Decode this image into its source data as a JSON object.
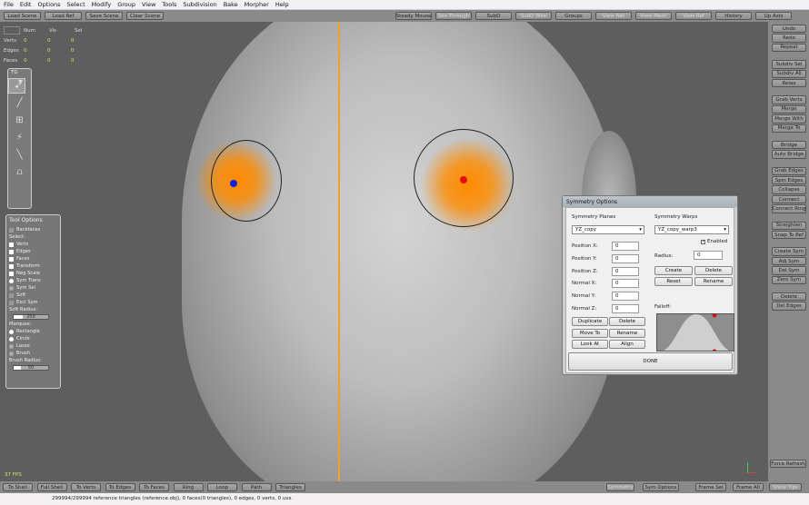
{
  "menu": [
    "File",
    "Edit",
    "Options",
    "Select",
    "Modify",
    "Group",
    "View",
    "Tools",
    "Subdivision",
    "Bake",
    "Morpher",
    "Help"
  ],
  "toolbar_left": [
    "Load Scene",
    "Load Ref",
    "Save Scene",
    "Clear Scene"
  ],
  "toolbar_right": [
    "Steady Mouse",
    "See Through",
    "SubD",
    "SubD Wire",
    "Groups",
    "View Net",
    "View Mesh",
    "View Ref",
    "History",
    "Up Axis"
  ],
  "stats": {
    "headers": [
      "Num",
      "Vis",
      "Sel"
    ],
    "rows": [
      {
        "label": "Verts",
        "values": [
          "0",
          "0",
          "0"
        ]
      },
      {
        "label": "Edges",
        "values": [
          "0",
          "0",
          "0"
        ]
      },
      {
        "label": "Faces",
        "values": [
          "0",
          "0",
          "0"
        ]
      }
    ]
  },
  "toolbox": {
    "title": "TG",
    "icons": [
      "select-arrow-icon",
      "cut-icon",
      "knife-icon",
      "extrude-icon",
      "brush-icon",
      "paint-icon",
      "stamp-icon"
    ]
  },
  "tool_options": {
    "title": "Tool Options",
    "backfaces": "Backfaces",
    "select_label": "Select:",
    "select_items": [
      "Verts",
      "Edges",
      "Faces"
    ],
    "transform_items": [
      "Transform",
      "Neg Scale",
      "Sym Trans",
      "Sym Sel",
      "Soft",
      "Excl Sym"
    ],
    "soft_radius_label": "Soft Radius:",
    "soft_radius": "200",
    "soft_radius_fill": 0.25,
    "marquee_label": "Marquee:",
    "marquee_items": [
      "Rectangle",
      "Circle",
      "Lasso",
      "Brush"
    ],
    "brush_radius_label": "Brush Radius:",
    "brush_radius": "50",
    "brush_radius_fill": 0.2
  },
  "fps": "37 FPS",
  "right_groups": [
    [
      "Undo",
      "Redo",
      "Repeat"
    ],
    [
      "Subdiv Sel",
      "Subdiv All",
      "Relax"
    ],
    [
      "Grab Verts",
      "Merge",
      "Merge With",
      "Merge To"
    ],
    [
      "Bridge",
      "Auto Bridge"
    ],
    [
      "Grab Edges",
      "Spin Edges",
      "Collapse",
      "Connect",
      "Connect Ring"
    ],
    [
      "Straighten",
      "Snap To Ref"
    ],
    [
      "Create Sym",
      "Adj Sym",
      "Del Sym",
      "Zero Sym"
    ],
    [
      "Delete",
      "Del Edges"
    ]
  ],
  "force_refresh": "Force Refresh",
  "bottom_left": [
    "To Shell",
    "Full Shell",
    "To Verts",
    "To Edges",
    "To Faces",
    "Ring",
    "Loop",
    "Path",
    "Triangles"
  ],
  "bottom_right": [
    "Symmetry",
    "Sym Options",
    "Frame Sel",
    "Frame All",
    "Show Tips"
  ],
  "status": "299994/299994 reference triangles (reference.obj), 0 faces(0 triangles), 0 edges, 0 verts, 0 uvs.",
  "dialog": {
    "title": "Symmetry Options",
    "planes_label": "Symmetry Planes",
    "plane_value": "YZ_copy",
    "warps_label": "Symmetry Warps",
    "warp_value": "YZ_copy_warp3",
    "enabled": "Enabled",
    "fields": [
      {
        "label": "Position X:",
        "value": "0"
      },
      {
        "label": "Position Y:",
        "value": "0"
      },
      {
        "label": "Position Z:",
        "value": "0"
      },
      {
        "label": "Normal X:",
        "value": "0"
      },
      {
        "label": "Normal Y:",
        "value": "0"
      },
      {
        "label": "Normal Z:",
        "value": "0"
      }
    ],
    "radius_label": "Radius:",
    "radius": "0",
    "warp_buttons": [
      "Create",
      "Delete",
      "Reset",
      "Rename"
    ],
    "falloff_label": "Falloff:",
    "plane_buttons": [
      "Duplicate",
      "Delete",
      "Move To",
      "Rename",
      "Look At",
      "Align"
    ],
    "done": "DONE"
  },
  "colors": {
    "glow": "#ff8a00",
    "blue_dot": "#1020e0",
    "red_dot": "#e01010",
    "sym_line": "#f0a030"
  }
}
